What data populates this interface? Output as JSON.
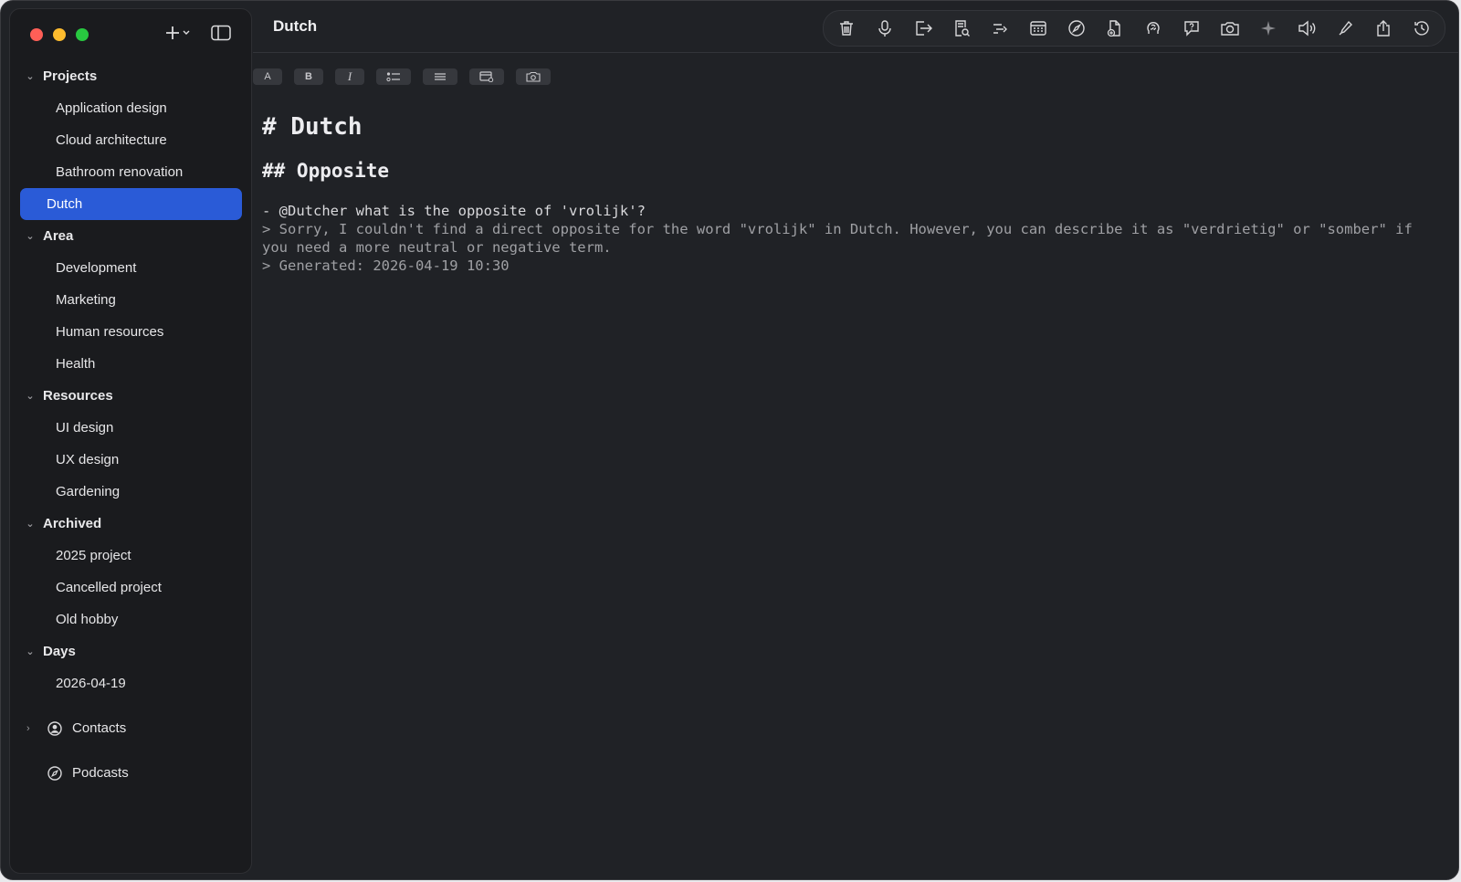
{
  "sidebar": {
    "sections": [
      {
        "title": "Projects",
        "items": [
          "Application design",
          "Cloud architecture",
          "Bathroom renovation",
          "Dutch"
        ]
      },
      {
        "title": "Area",
        "items": [
          "Development",
          "Marketing",
          "Human resources",
          "Health"
        ]
      },
      {
        "title": "Resources",
        "items": [
          "UI design",
          "UX design",
          "Gardening"
        ]
      },
      {
        "title": "Archived",
        "items": [
          "2025 project",
          "Cancelled project",
          "Old hobby"
        ]
      },
      {
        "title": "Days",
        "items": [
          "2026-04-19"
        ]
      }
    ],
    "active_item": "Dutch",
    "extras": {
      "contacts": "Contacts",
      "podcasts": "Podcasts"
    }
  },
  "header": {
    "title": "Dutch"
  },
  "toolbar": {
    "icons": [
      "trash-icon",
      "microphone-icon",
      "export-icon",
      "document-search-icon",
      "list-indent-icon",
      "calendar-icon",
      "compass-icon",
      "add-document-icon",
      "brain-icon",
      "speech-bubble-icon",
      "camera-icon",
      "sparkle-icon",
      "speaker-icon",
      "pen-icon",
      "share-icon",
      "history-icon"
    ]
  },
  "format_bar": {
    "font": "A",
    "bold": "B",
    "italic": "I"
  },
  "document": {
    "h1": "# Dutch",
    "h2": "## Opposite",
    "question": "- @Dutcher what is the opposite of 'vrolijk'?",
    "answer": "> Sorry, I couldn't find a direct opposite for the word \"vrolijk\" in Dutch. However, you can describe it as \"verdrietig\" or \"somber\" if you need a more neutral or negative term.",
    "generated": "> Generated: 2026-04-19 10:30"
  },
  "colors": {
    "accent": "#2a5bd7",
    "background": "#202226",
    "sidebar": "#1a1b1e"
  }
}
